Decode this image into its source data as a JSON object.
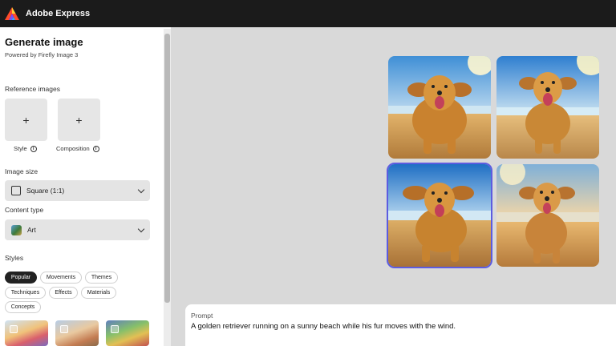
{
  "app": {
    "title": "Adobe Express",
    "logo": "adobe-express-logo"
  },
  "panel": {
    "title": "Generate image",
    "subtitle": "Powered by Firefly Image 3",
    "reference": {
      "label": "Reference images",
      "tiles": [
        {
          "label": "Style",
          "icon": "plus-icon",
          "glyph": "+"
        },
        {
          "label": "Composition",
          "icon": "plus-icon",
          "glyph": "+"
        }
      ]
    },
    "image_size": {
      "label": "Image size",
      "value": "Square (1:1)"
    },
    "content_type": {
      "label": "Content type",
      "value": "Art"
    },
    "styles": {
      "label": "Styles",
      "tabs": [
        {
          "label": "Popular",
          "active": true
        },
        {
          "label": "Movements",
          "active": false
        },
        {
          "label": "Themes",
          "active": false
        },
        {
          "label": "Techniques",
          "active": false
        },
        {
          "label": "Effects",
          "active": false
        },
        {
          "label": "Materials",
          "active": false
        },
        {
          "label": "Concepts",
          "active": false
        }
      ]
    }
  },
  "results": {
    "count": 4,
    "selected_index": 2,
    "accent": "#5c5ce0"
  },
  "prompt": {
    "label": "Prompt",
    "value": "A golden retriever running on a sunny beach while his fur moves with the wind."
  },
  "colors": {
    "topbar": "#1b1b1b",
    "canvas": "#d9d9d9",
    "active_pill": "#222222"
  }
}
